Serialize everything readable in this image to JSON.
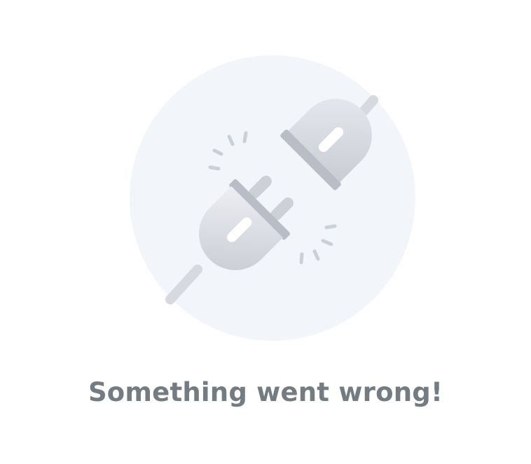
{
  "error": {
    "title": "Something went wrong!",
    "illustration_icon": "unplugged-icon"
  },
  "colors": {
    "circle_background": "#f2f5fa",
    "plug_light": "#e4e7ee",
    "plug_dark": "#bfc3cb",
    "cable": "#d4d7de",
    "spark": "#c8ccd4",
    "title_text": "#737b83"
  }
}
